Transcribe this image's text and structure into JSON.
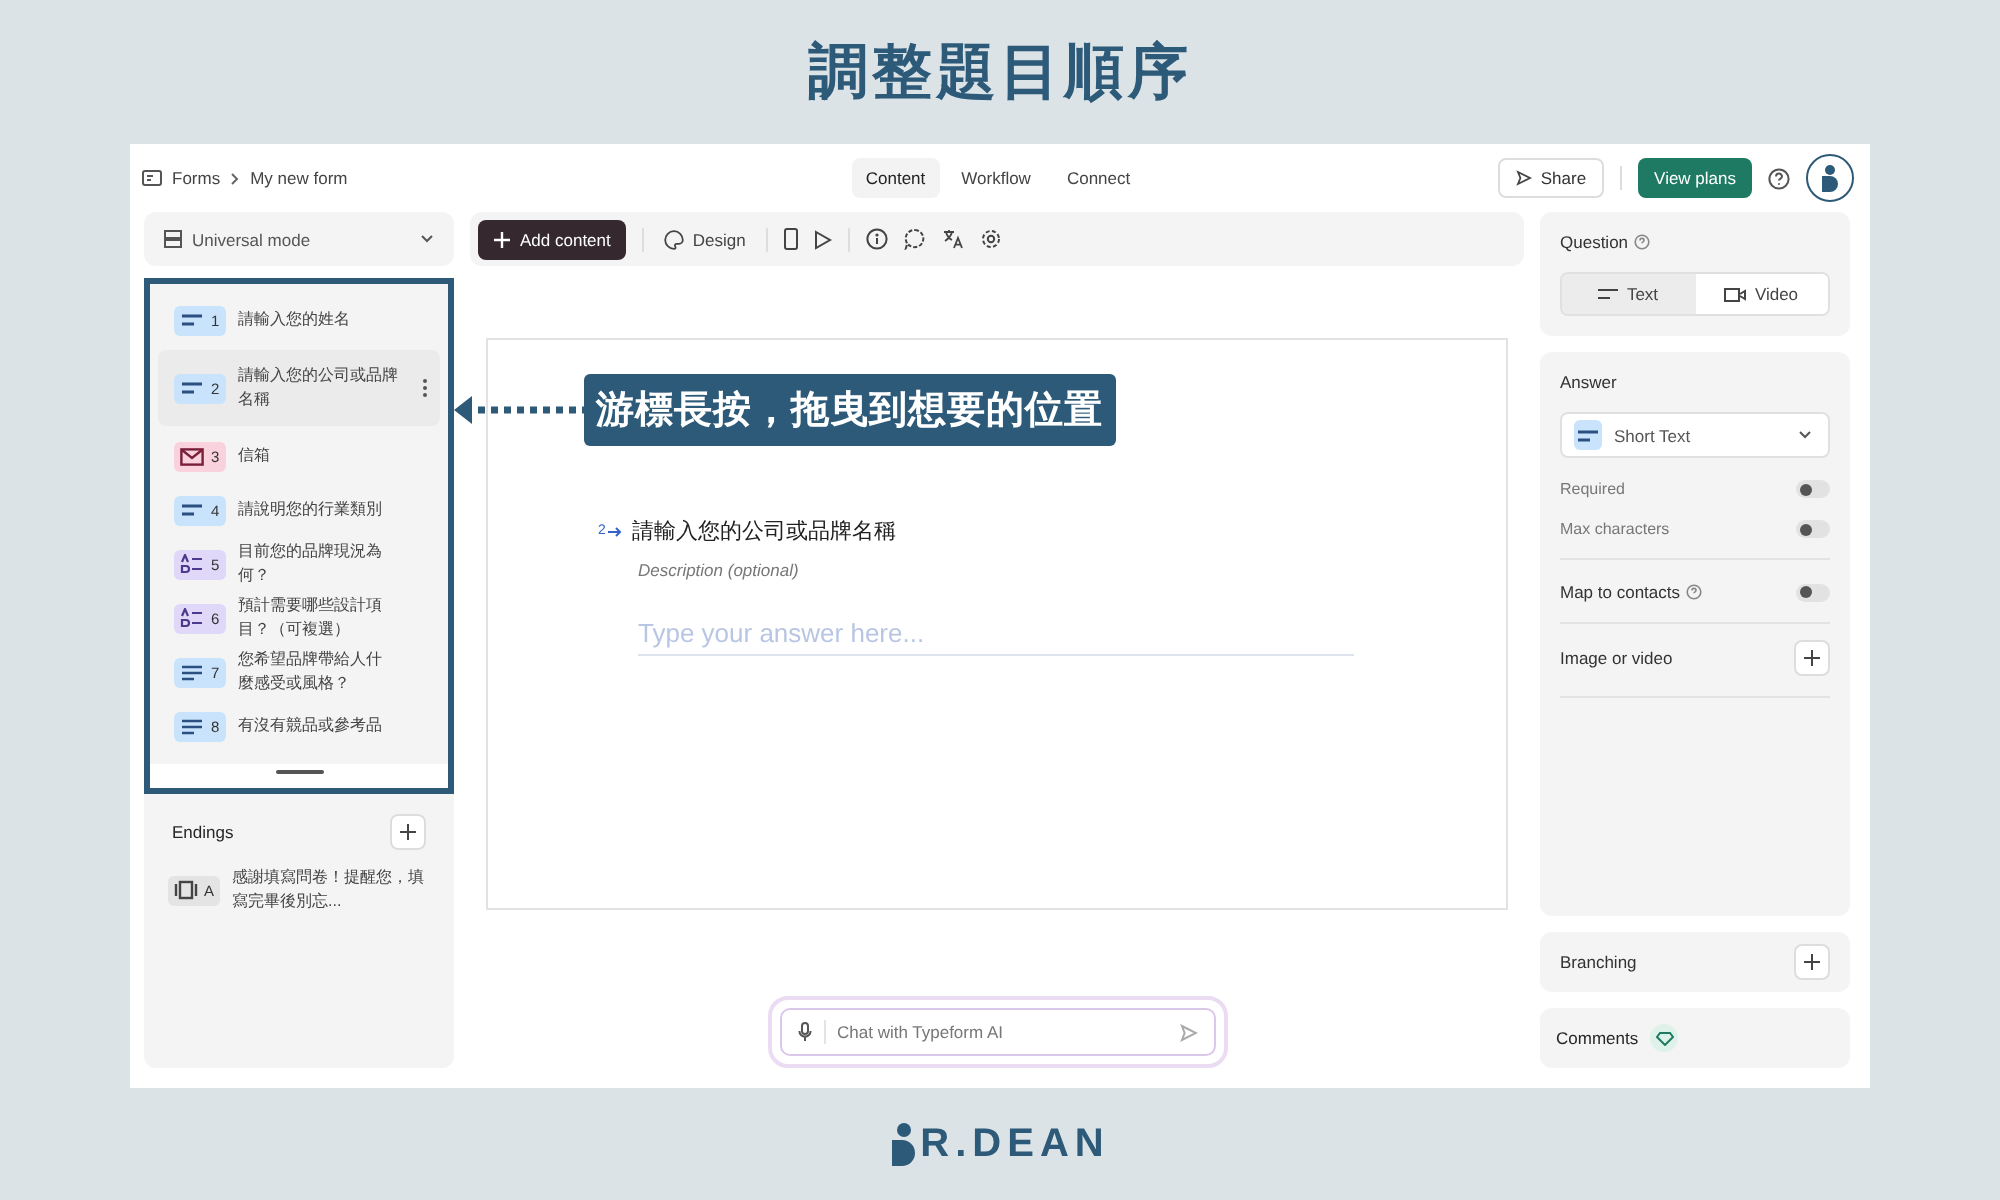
{
  "page_title": "調整題目順序",
  "breadcrumb": [
    "Forms",
    "My new form"
  ],
  "nav_tabs": [
    {
      "label": "Content",
      "selected": true
    },
    {
      "label": "Workflow",
      "selected": false
    },
    {
      "label": "Connect",
      "selected": false
    }
  ],
  "share_button": "Share",
  "plans_button": "View plans",
  "mode_select": "Universal mode",
  "questions": [
    {
      "kind": "short",
      "number": "1",
      "text": "請輸入您的姓名"
    },
    {
      "kind": "gap"
    },
    {
      "kind": "email",
      "number": "3",
      "text": "信箱"
    },
    {
      "kind": "short",
      "number": "4",
      "text": "請說明您的行業類別"
    },
    {
      "kind": "choice",
      "number": "5",
      "text": "目前您的品牌現況為何？"
    },
    {
      "kind": "choice",
      "number": "6",
      "text": "預計需要哪些設計項目？（可複選）"
    },
    {
      "kind": "long",
      "number": "7",
      "text": "您希望品牌帶給人什麼感受或風格？"
    },
    {
      "kind": "long",
      "number": "8",
      "text": "有沒有競品或參考品"
    }
  ],
  "dragged": {
    "kind": "short",
    "number": "2",
    "text": "請輸入您的公司或品牌名稱"
  },
  "endings_title": "Endings",
  "endings": [
    {
      "kind": "ending",
      "number": "A",
      "text": "感謝填寫問卷！提醒您，填寫完畢後別忘..."
    }
  ],
  "add_button": "Add content",
  "design_button": "Design",
  "callout": "游標長按，拖曳到想要的位置",
  "question": {
    "number": "2",
    "title": "請輸入您的公司或品牌名稱",
    "description_placeholder": "Description (optional)",
    "answer_placeholder": "Type your answer here..."
  },
  "chat_placeholder": "Chat with Typeform AI",
  "question_panel": {
    "title": "Question",
    "segments": [
      {
        "label": "Text",
        "selected": true
      },
      {
        "label": "Video",
        "selected": false
      }
    ]
  },
  "answer_panel": {
    "title": "Answer",
    "type": "Short Text",
    "toggles": [
      {
        "label": "Required",
        "on": false
      },
      {
        "label": "Max characters",
        "on": false
      }
    ],
    "map_toggle": {
      "label": "Map to contacts",
      "on": false
    },
    "media_label": "Image or video"
  },
  "branching": "Branching",
  "comments": "Comments",
  "logo_text": "R.DEAN"
}
